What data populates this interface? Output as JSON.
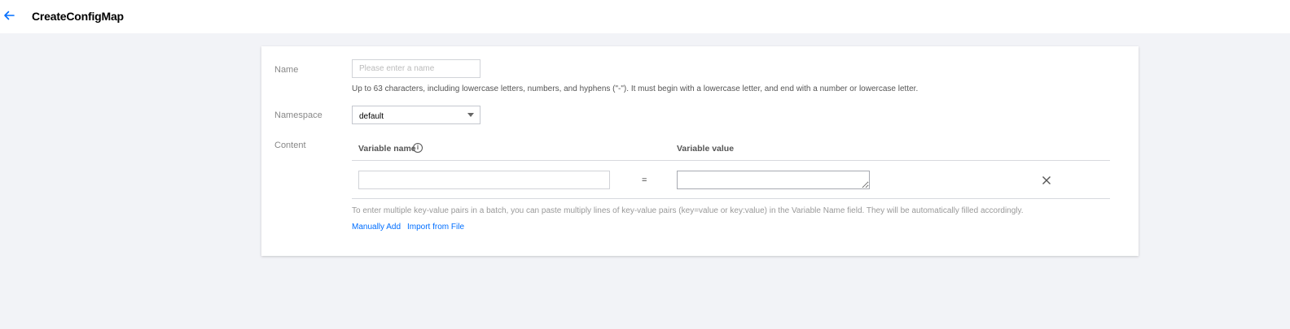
{
  "header": {
    "back_icon": "arrow-left-icon",
    "title": "CreateConfigMap",
    "accent_color": "#006eff"
  },
  "form": {
    "name": {
      "label": "Name",
      "placeholder": "Please enter a name",
      "value": "",
      "help": "Up to 63 characters, including lowercase letters, numbers, and hyphens (\"-\"). It must begin with a lowercase letter, and end with a number or lowercase letter."
    },
    "namespace": {
      "label": "Namespace",
      "selected": "default",
      "icon": "caret-down-icon"
    },
    "content": {
      "label": "Content",
      "columns": {
        "name": "Variable name",
        "value": "Variable value"
      },
      "info_icon": "info-icon",
      "rows": [
        {
          "name": "",
          "separator": "=",
          "value": "",
          "remove_icon": "close-icon"
        }
      ],
      "hint": "To enter multiple key-value pairs in a batch, you can paste multiply lines of key-value pairs (key=value or key:value) in the Variable Name field. They will be automatically filled accordingly.",
      "actions": {
        "manual_add": "Manually Add",
        "import_file": "Import from File"
      }
    }
  }
}
